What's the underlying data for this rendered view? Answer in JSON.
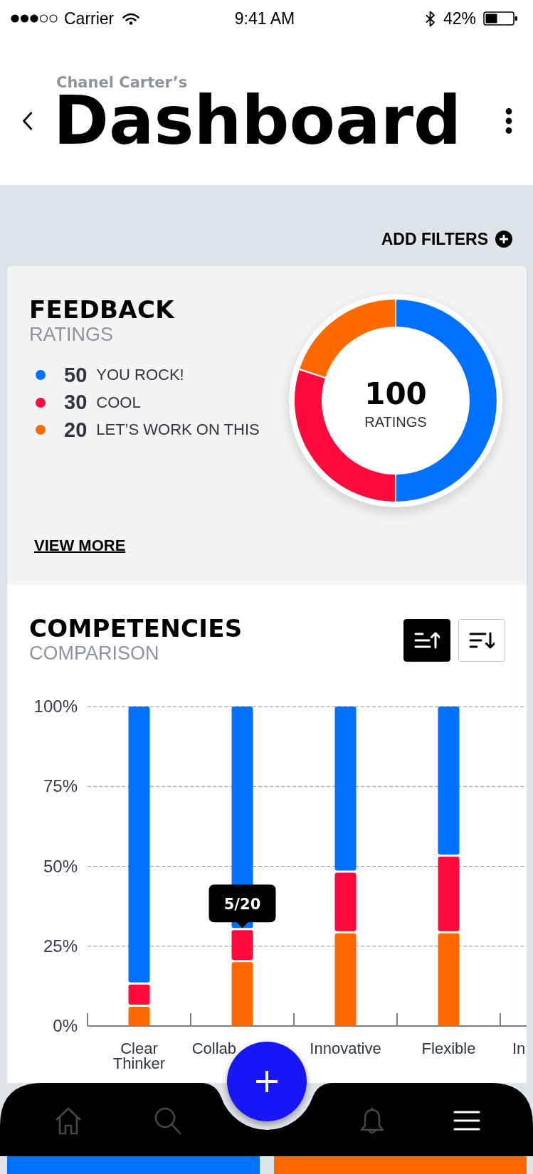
{
  "status_bar": {
    "carrier": "Carrier",
    "time": "9:41 AM",
    "battery": "42%"
  },
  "header": {
    "owner": "Chanel Carter’s",
    "title": "Dashboard"
  },
  "filters": {
    "label": "ADD FILTERS"
  },
  "feedback": {
    "title": "FEEDBACK",
    "subtitle": "RATINGS",
    "legend": [
      {
        "count": "50",
        "label": "YOU ROCK!",
        "color": "#0070ff"
      },
      {
        "count": "30",
        "label": "COOL",
        "color": "#fe0b3d"
      },
      {
        "count": "20",
        "label": "LET’S WORK ON THIS",
        "color": "#ff6a00"
      }
    ],
    "chart_data": {
      "type": "donut",
      "values": [
        50,
        30,
        20
      ]
    },
    "total": "100",
    "total_label": "RATINGS",
    "link": "VIEW MORE"
  },
  "competencies": {
    "title": "COMPETENCIES",
    "subtitle": "COMPARISON",
    "sort_buttons": [
      {
        "kind": "ascending",
        "selected": true
      },
      {
        "kind": "descending",
        "selected": false
      }
    ],
    "chart_data": {
      "type": "bar",
      "stacked": true,
      "grid": true,
      "categories": [
        "Clear Thinker",
        "Collab",
        "Innovative",
        "Flexible",
        "In"
      ],
      "series": [
        {
          "color": "#ff6a00",
          "values": [
            6,
            20,
            29,
            29,
            null
          ]
        },
        {
          "color": "#fe0b3d",
          "values": [
            7,
            10,
            19,
            24,
            null
          ]
        },
        {
          "color": "#0070ff",
          "values": [
            87,
            70,
            52,
            47,
            null
          ]
        }
      ],
      "ylim": [
        0,
        100
      ],
      "yticks": [
        {
          "value": 0,
          "label": "0%"
        },
        {
          "value": 25,
          "label": "25%"
        },
        {
          "value": 50,
          "label": "50%"
        },
        {
          "value": 75,
          "label": "75%"
        },
        {
          "value": 100,
          "label": "100%"
        }
      ]
    },
    "tooltip": "5/20"
  },
  "summary_cards": [
    {
      "color": "#0070ff"
    },
    {
      "color": "#ff6a00"
    }
  ],
  "nav": {
    "items": [
      {
        "kind": "home",
        "selected": false
      },
      {
        "kind": "search",
        "selected": false
      },
      {
        "kind": "bell",
        "selected": false
      },
      {
        "kind": "menu",
        "selected": true
      }
    ]
  }
}
